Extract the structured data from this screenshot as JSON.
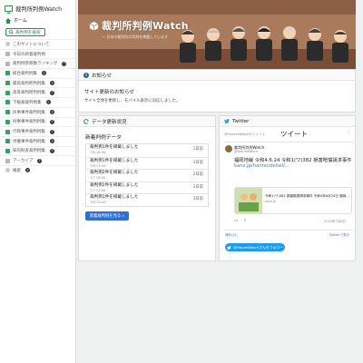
{
  "sidebar": {
    "brand": "裁判所判例Watch",
    "home": "ホーム",
    "search_button": "裁判例を検索",
    "items": [
      {
        "label": "このサイトについて",
        "icon": "info-icon",
        "badge": ""
      },
      {
        "label": "今日の新着裁判例",
        "icon": "calendar-icon",
        "badge": ""
      },
      {
        "label": "裁判例参照数ランキング",
        "icon": "ranking-icon",
        "badge": "?"
      },
      {
        "label": "総合裁判例集",
        "icon": "book-icon",
        "badge": "?"
      },
      {
        "label": "最高裁判所判例集",
        "icon": "book-icon",
        "badge": "?"
      },
      {
        "label": "高等裁判所判例集",
        "icon": "book-icon",
        "badge": "?"
      },
      {
        "label": "下級裁裁判例集",
        "icon": "book-icon",
        "badge": "?"
      },
      {
        "label": "民事事件裁判例集",
        "icon": "book-icon",
        "badge": "?"
      },
      {
        "label": "刑事事件裁判例集",
        "icon": "book-icon",
        "badge": "?"
      },
      {
        "label": "行政事件裁判例集",
        "icon": "book-icon",
        "badge": "?"
      },
      {
        "label": "労働事件裁判例集",
        "icon": "book-icon",
        "badge": "?"
      },
      {
        "label": "知的財産裁判例集",
        "icon": "book-icon",
        "badge": "?"
      },
      {
        "label": "アーカイブ",
        "icon": "archive-icon",
        "badge": "?"
      },
      {
        "label": "検索",
        "icon": "search-icon",
        "badge": "?"
      }
    ]
  },
  "header": {
    "title": "裁判所判例Watch",
    "subtitle": "ー 日本の裁判所の判例を掲載しています"
  },
  "notice": {
    "heading": "お知らせ",
    "title": "サイト更新のお知らせ",
    "text": "サイト全体を更新し、モバイル表示に対応しました。"
  },
  "updates": {
    "heading": "データ更新状況",
    "section_title": "新着判例データ",
    "rows": [
      {
        "title": "裁判例1件を掲載しました",
        "date": "7/8 18:00",
        "meta": "1日前"
      },
      {
        "title": "裁判例1件を掲載しました",
        "date": "7/8 13:00",
        "meta": "1日前"
      },
      {
        "title": "裁判例2件を掲載しました",
        "date": "7/7 18:00",
        "meta": "2日前"
      },
      {
        "title": "裁判例2件を掲載しました",
        "date": "7/7 17:00",
        "meta": "2日前"
      },
      {
        "title": "裁判例1件を掲載しました",
        "date": "7/6 13:00",
        "meta": "3日前"
      }
    ],
    "more_button": "新着裁判例を見る »"
  },
  "twitter": {
    "heading": "Twitter",
    "handle": "@HanreiWatchのツイート",
    "tweet_heading": "ツイート",
    "name": "裁判所判例Watch",
    "at": "@HanreiWatch",
    "text": "福岡地裁 令和4.6.24 令和1(ワ)382 損害賠償請求事件",
    "link": "kanz.jp/hanrei/detail/…",
    "embed_title": "令和1(ワ)382 損害賠償請求事件 令和4年6月24日 福岡…",
    "embed_domain": "kanz.jp",
    "date": "2022年7月8日",
    "embed_link": "埋め込む",
    "view_link": "Twitterで表示",
    "follow": "@HanreiWatchさんをフォロー"
  },
  "colors": {
    "accent": "#2a8c4f",
    "link": "#3a7bd5",
    "button": "#2f6fd0",
    "twitter": "#1d9bf0"
  }
}
